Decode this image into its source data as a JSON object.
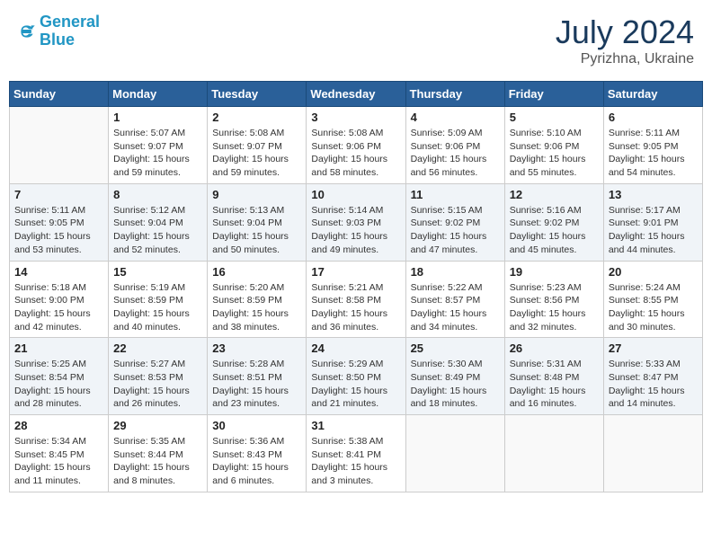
{
  "header": {
    "logo_line1": "General",
    "logo_line2": "Blue",
    "month_year": "July 2024",
    "location": "Pyrizhna, Ukraine"
  },
  "weekdays": [
    "Sunday",
    "Monday",
    "Tuesday",
    "Wednesday",
    "Thursday",
    "Friday",
    "Saturday"
  ],
  "weeks": [
    [
      {
        "day": "",
        "sunrise": "",
        "sunset": "",
        "daylight": ""
      },
      {
        "day": "1",
        "sunrise": "5:07 AM",
        "sunset": "9:07 PM",
        "hours": "15",
        "minutes": "59"
      },
      {
        "day": "2",
        "sunrise": "5:08 AM",
        "sunset": "9:07 PM",
        "hours": "15",
        "minutes": "59"
      },
      {
        "day": "3",
        "sunrise": "5:08 AM",
        "sunset": "9:06 PM",
        "hours": "15",
        "minutes": "58"
      },
      {
        "day": "4",
        "sunrise": "5:09 AM",
        "sunset": "9:06 PM",
        "hours": "15",
        "minutes": "56"
      },
      {
        "day": "5",
        "sunrise": "5:10 AM",
        "sunset": "9:06 PM",
        "hours": "15",
        "minutes": "55"
      },
      {
        "day": "6",
        "sunrise": "5:11 AM",
        "sunset": "9:05 PM",
        "hours": "15",
        "minutes": "54"
      }
    ],
    [
      {
        "day": "7",
        "sunrise": "5:11 AM",
        "sunset": "9:05 PM",
        "hours": "15",
        "minutes": "53"
      },
      {
        "day": "8",
        "sunrise": "5:12 AM",
        "sunset": "9:04 PM",
        "hours": "15",
        "minutes": "52"
      },
      {
        "day": "9",
        "sunrise": "5:13 AM",
        "sunset": "9:04 PM",
        "hours": "15",
        "minutes": "50"
      },
      {
        "day": "10",
        "sunrise": "5:14 AM",
        "sunset": "9:03 PM",
        "hours": "15",
        "minutes": "49"
      },
      {
        "day": "11",
        "sunrise": "5:15 AM",
        "sunset": "9:02 PM",
        "hours": "15",
        "minutes": "47"
      },
      {
        "day": "12",
        "sunrise": "5:16 AM",
        "sunset": "9:02 PM",
        "hours": "15",
        "minutes": "45"
      },
      {
        "day": "13",
        "sunrise": "5:17 AM",
        "sunset": "9:01 PM",
        "hours": "15",
        "minutes": "44"
      }
    ],
    [
      {
        "day": "14",
        "sunrise": "5:18 AM",
        "sunset": "9:00 PM",
        "hours": "15",
        "minutes": "42"
      },
      {
        "day": "15",
        "sunrise": "5:19 AM",
        "sunset": "8:59 PM",
        "hours": "15",
        "minutes": "40"
      },
      {
        "day": "16",
        "sunrise": "5:20 AM",
        "sunset": "8:59 PM",
        "hours": "15",
        "minutes": "38"
      },
      {
        "day": "17",
        "sunrise": "5:21 AM",
        "sunset": "8:58 PM",
        "hours": "15",
        "minutes": "36"
      },
      {
        "day": "18",
        "sunrise": "5:22 AM",
        "sunset": "8:57 PM",
        "hours": "15",
        "minutes": "34"
      },
      {
        "day": "19",
        "sunrise": "5:23 AM",
        "sunset": "8:56 PM",
        "hours": "15",
        "minutes": "32"
      },
      {
        "day": "20",
        "sunrise": "5:24 AM",
        "sunset": "8:55 PM",
        "hours": "15",
        "minutes": "30"
      }
    ],
    [
      {
        "day": "21",
        "sunrise": "5:25 AM",
        "sunset": "8:54 PM",
        "hours": "15",
        "minutes": "28"
      },
      {
        "day": "22",
        "sunrise": "5:27 AM",
        "sunset": "8:53 PM",
        "hours": "15",
        "minutes": "26"
      },
      {
        "day": "23",
        "sunrise": "5:28 AM",
        "sunset": "8:51 PM",
        "hours": "15",
        "minutes": "23"
      },
      {
        "day": "24",
        "sunrise": "5:29 AM",
        "sunset": "8:50 PM",
        "hours": "15",
        "minutes": "21"
      },
      {
        "day": "25",
        "sunrise": "5:30 AM",
        "sunset": "8:49 PM",
        "hours": "15",
        "minutes": "18"
      },
      {
        "day": "26",
        "sunrise": "5:31 AM",
        "sunset": "8:48 PM",
        "hours": "15",
        "minutes": "16"
      },
      {
        "day": "27",
        "sunrise": "5:33 AM",
        "sunset": "8:47 PM",
        "hours": "15",
        "minutes": "14"
      }
    ],
    [
      {
        "day": "28",
        "sunrise": "5:34 AM",
        "sunset": "8:45 PM",
        "hours": "15",
        "minutes": "11"
      },
      {
        "day": "29",
        "sunrise": "5:35 AM",
        "sunset": "8:44 PM",
        "hours": "15",
        "minutes": "8"
      },
      {
        "day": "30",
        "sunrise": "5:36 AM",
        "sunset": "8:43 PM",
        "hours": "15",
        "minutes": "6"
      },
      {
        "day": "31",
        "sunrise": "5:38 AM",
        "sunset": "8:41 PM",
        "hours": "15",
        "minutes": "3"
      },
      {
        "day": "",
        "sunrise": "",
        "sunset": "",
        "hours": "",
        "minutes": ""
      },
      {
        "day": "",
        "sunrise": "",
        "sunset": "",
        "hours": "",
        "minutes": ""
      },
      {
        "day": "",
        "sunrise": "",
        "sunset": "",
        "hours": "",
        "minutes": ""
      }
    ]
  ]
}
